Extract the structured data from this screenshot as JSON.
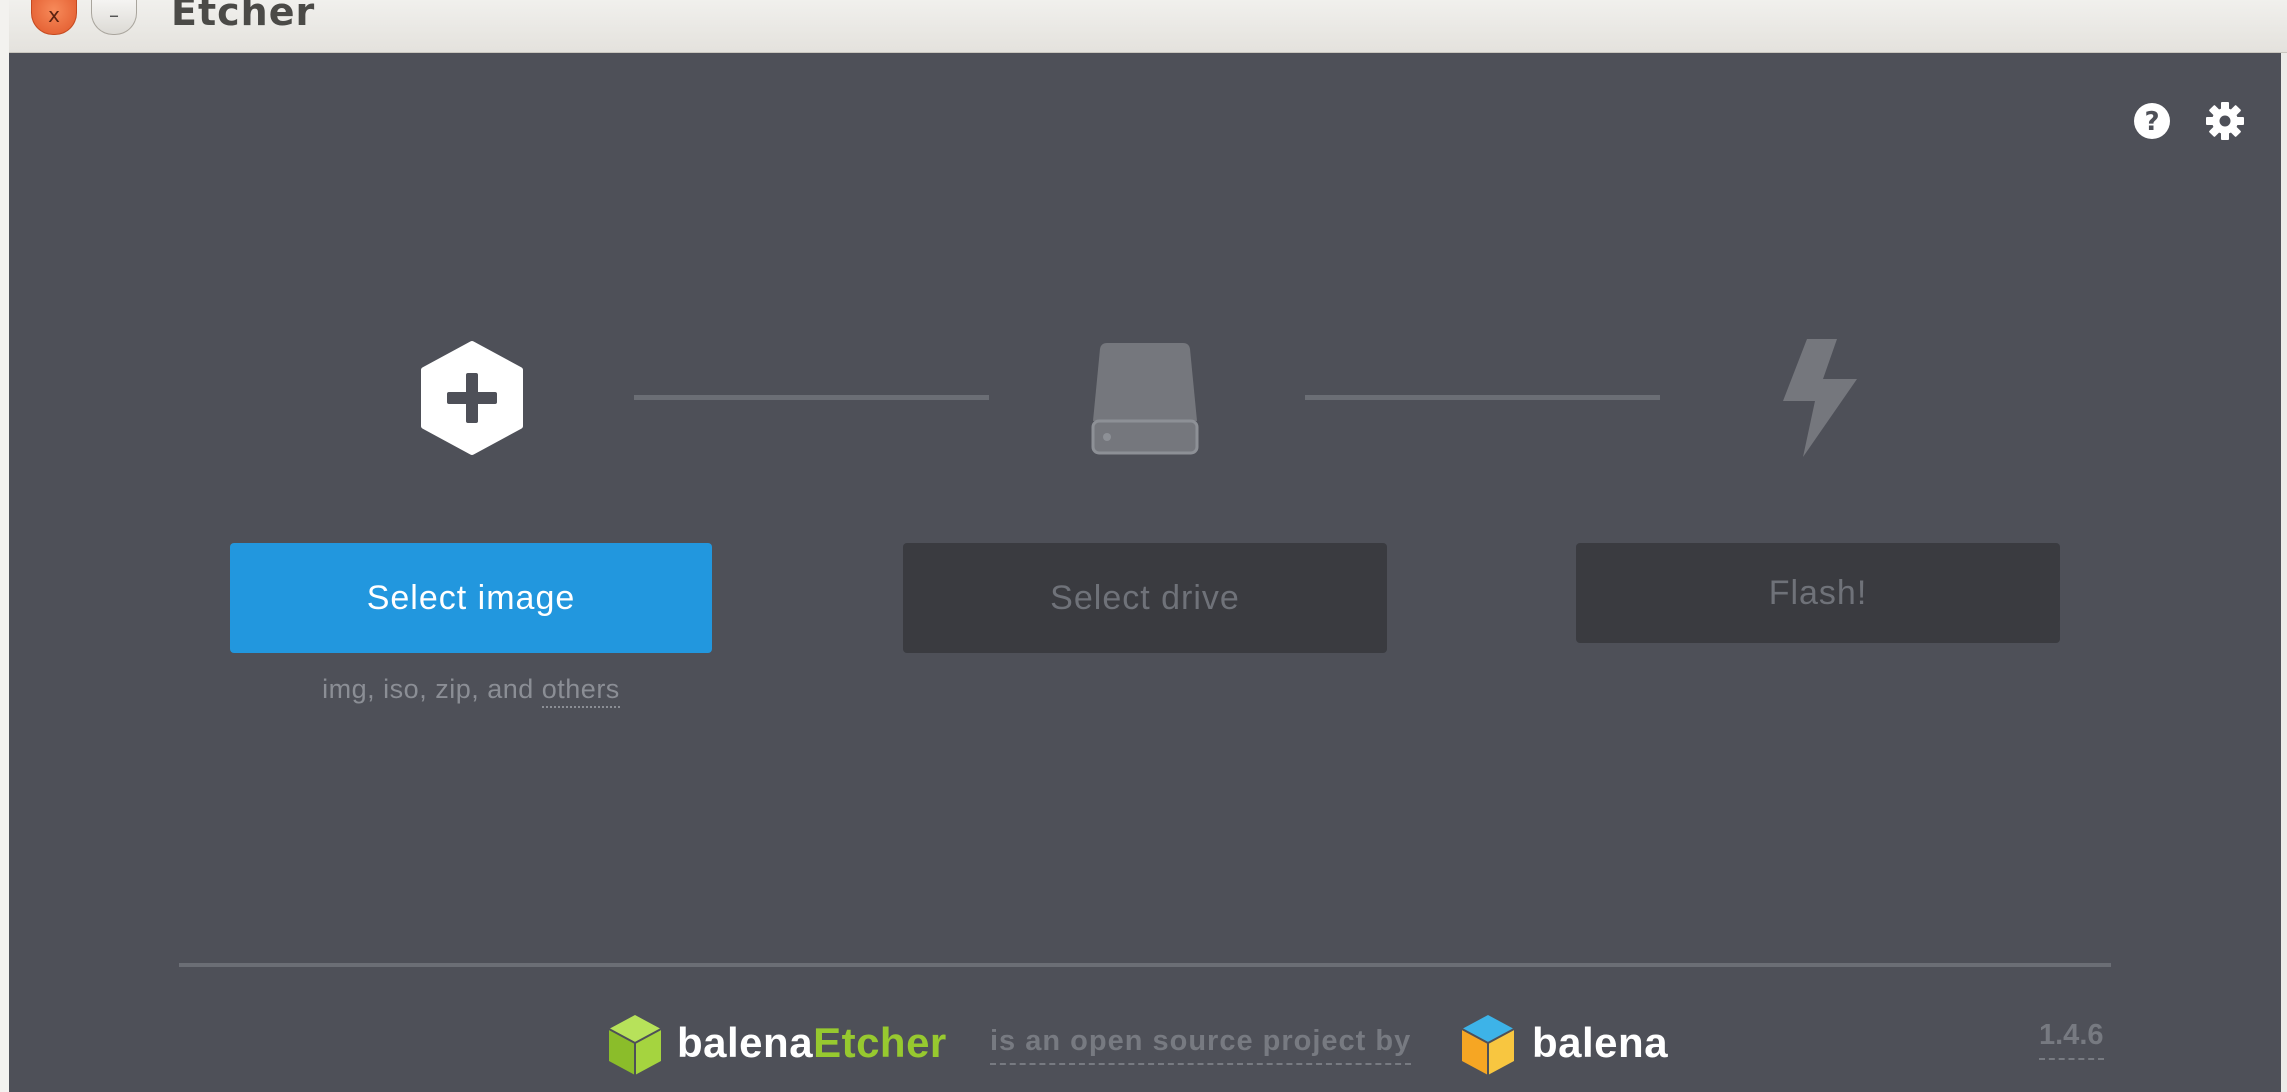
{
  "window": {
    "title": "Etcher",
    "close_glyph": "x",
    "minimize_glyph": "–"
  },
  "header": {
    "help_icon": "help-circle-icon",
    "settings_icon": "gear-icon"
  },
  "steps": [
    {
      "icon": "hexagon-plus-icon",
      "button_label": "Select image",
      "state": "active",
      "hint": "img, iso, zip, and ",
      "hint_link": "others"
    },
    {
      "icon": "drive-icon",
      "button_label": "Select drive",
      "state": "disabled"
    },
    {
      "icon": "lightning-bolt-icon",
      "button_label": "Flash!",
      "state": "disabled"
    }
  ],
  "footer": {
    "product_name_prefix": "balena",
    "product_name_accent": "Etcher",
    "tagline": "is an open source project by",
    "company": "balena",
    "version": "1.4.6"
  },
  "colors": {
    "app_background": "#4e5058",
    "primary_button": "#2297de",
    "disabled_button": "#3a3b40",
    "accent_green": "#97c92f"
  }
}
